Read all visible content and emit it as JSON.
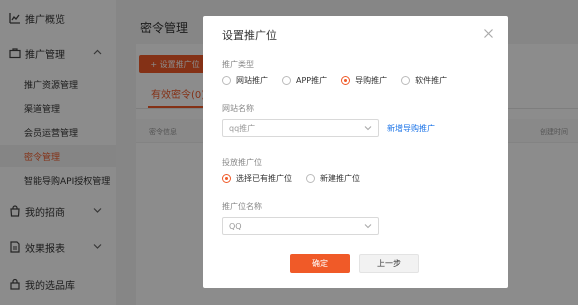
{
  "sidebar": {
    "overview": "推广概览",
    "promo_mgmt": "推广管理",
    "sub_items": [
      "推广资源管理",
      "渠道管理",
      "会员运营管理",
      "密令管理",
      "智能导购API授权管理"
    ],
    "active_sub": "密令管理",
    "recruit": "我的招商",
    "reports": "效果报表",
    "selection": "我的选品库"
  },
  "main": {
    "title": "密令管理",
    "add_button": "+ 设置推广位",
    "tab_active": "有效密令(0)",
    "col_left": "密令信息",
    "col_right": "创建时间"
  },
  "modal": {
    "title": "设置推广位",
    "type_label": "推广类型",
    "type_options": [
      "网站推广",
      "APP推广",
      "导购推广",
      "软件推广"
    ],
    "type_selected": "导购推广",
    "site_label": "网站名称",
    "site_value": "qq推广",
    "new_link": "新增导购推广",
    "position_label": "投放推广位",
    "position_options": [
      "选择已有推广位",
      "新建推广位"
    ],
    "position_selected": "选择已有推广位",
    "name_label": "推广位名称",
    "name_value": "QQ",
    "ok": "确定",
    "back": "上一步"
  },
  "colors": {
    "accent": "#f05a28",
    "link": "#1a73e8"
  },
  "icons": [
    "chart-icon",
    "briefcase-icon",
    "shopping-bag-icon",
    "document-icon",
    "lock-icon",
    "chevron-up-icon",
    "chevron-down-icon",
    "close-icon"
  ]
}
